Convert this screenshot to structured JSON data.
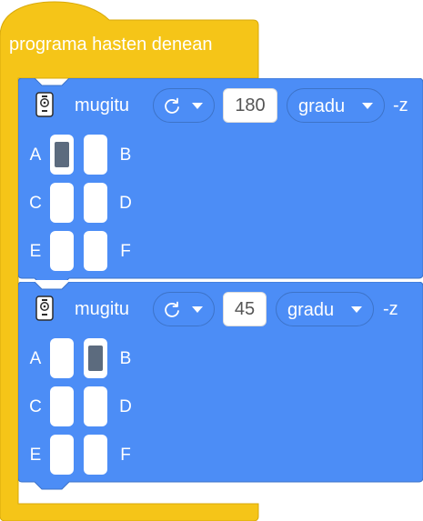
{
  "hat_block": {
    "label": "programa hasten denean",
    "color": "#f5c518"
  },
  "blocks": [
    {
      "keyword": "mugitu",
      "direction_icon": "rotate-clockwise-icon",
      "amount": "180",
      "unit": "gradu",
      "axis": "-z",
      "ports": [
        {
          "name": "A",
          "selected": true
        },
        {
          "name": "B",
          "selected": false
        },
        {
          "name": "C",
          "selected": false
        },
        {
          "name": "D",
          "selected": false
        },
        {
          "name": "E",
          "selected": false
        },
        {
          "name": "F",
          "selected": false
        }
      ]
    },
    {
      "keyword": "mugitu",
      "direction_icon": "rotate-clockwise-icon",
      "amount": "45",
      "unit": "gradu",
      "axis": "-z",
      "ports": [
        {
          "name": "A",
          "selected": false
        },
        {
          "name": "B",
          "selected": true
        },
        {
          "name": "C",
          "selected": false
        },
        {
          "name": "D",
          "selected": false
        },
        {
          "name": "E",
          "selected": false
        },
        {
          "name": "F",
          "selected": false
        }
      ]
    }
  ],
  "colors": {
    "block_blue": "#4c8df6",
    "block_border": "#3d73c8",
    "port_selected": "#5c6b7e"
  }
}
